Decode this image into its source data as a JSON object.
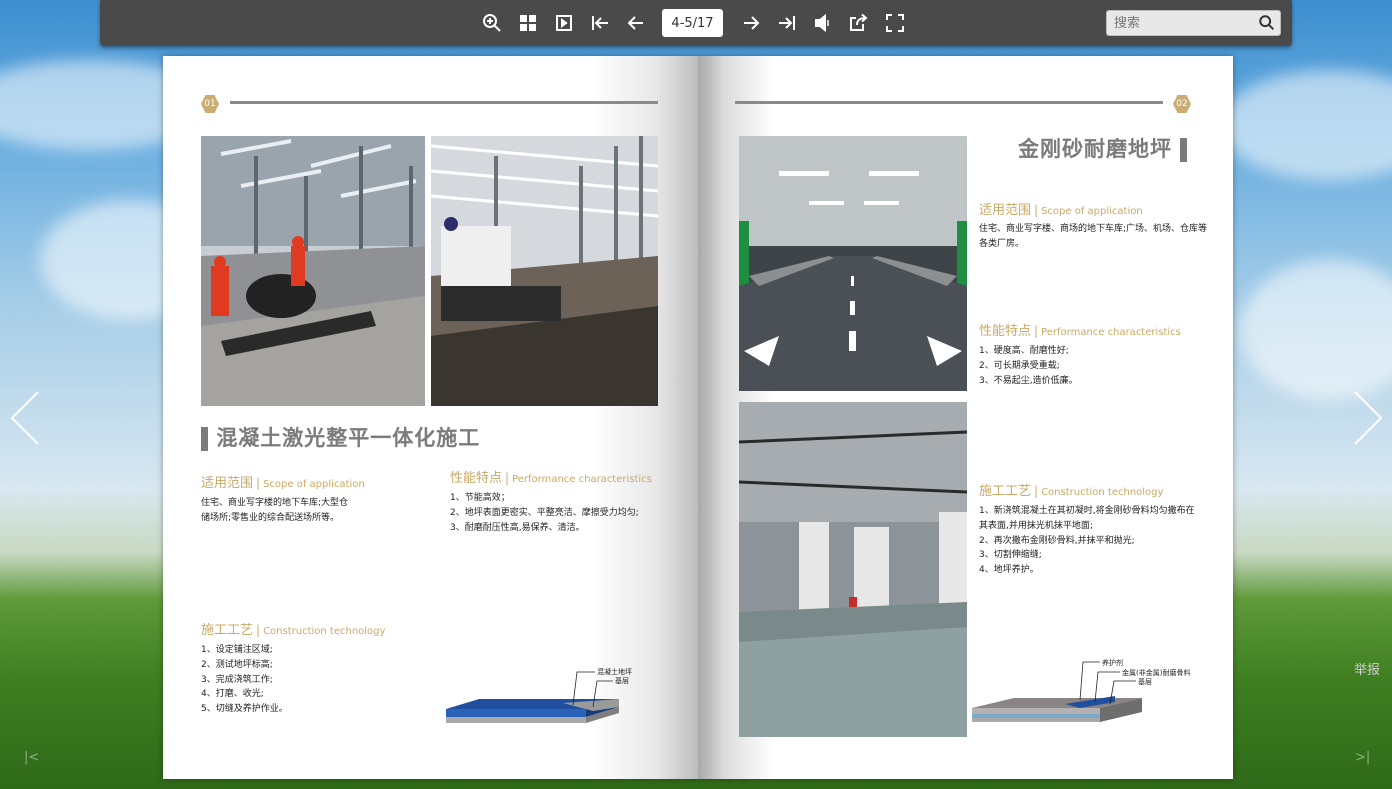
{
  "toolbar": {
    "page_indicator": "4-5/17",
    "search_placeholder": "搜索"
  },
  "left_page": {
    "number": "01",
    "title": "混凝土激光整平一体化施工",
    "scope": {
      "cn": "适用范围",
      "sep": "|",
      "en": "Scope of application",
      "lines": [
        "住宅、商业写字楼的地下车库;大型仓",
        "储场所;零售业的综合配送场所等。"
      ]
    },
    "performance": {
      "cn": "性能特点",
      "sep": "|",
      "en": "Performance characteristics",
      "lines": [
        "1、节能高效；",
        "2、地坪表面更密实、平整亮洁、摩擦受力均匀;",
        "3、耐磨耐压性高,易保养、清洁。"
      ]
    },
    "construction": {
      "cn": "施工工艺",
      "sep": "|",
      "en": "Construction technology",
      "lines": [
        "1、设定铺注区域;",
        "2、测试地坪标高;",
        "3、完成浇筑工作;",
        "4、打磨、收光;",
        "5、切缝及养护作业。"
      ]
    },
    "diagram_labels": [
      "混凝土地坪",
      "基层"
    ]
  },
  "right_page": {
    "number": "02",
    "title": "金刚砂耐磨地坪",
    "scope": {
      "cn": "适用范围",
      "sep": "|",
      "en": "Scope of application",
      "lines": [
        "住宅、商业写字楼、商场的地下车库;广场、机场、仓库等",
        "各类厂房。"
      ]
    },
    "performance": {
      "cn": "性能特点",
      "sep": "|",
      "en": "Performance characteristics",
      "lines": [
        "1、硬度高、耐磨性好;",
        "2、可长期承受重载;",
        "3、不易起尘,造价低廉。"
      ]
    },
    "construction": {
      "cn": "施工工艺",
      "sep": "|",
      "en": "Construction technology",
      "lines": [
        "1、新浇筑混凝土在其初凝时,将金刚砂骨料均匀撒布在",
        "其表面,并用抹光机抹平地面;",
        "2、再次撒布金刚砂骨料,并抹平和抛光;",
        "3、切割伸缩缝;",
        "4、地坪养护。"
      ]
    },
    "diagram_labels": [
      "养护剂",
      "金属(非金属)耐磨骨料",
      "基层"
    ]
  },
  "report_label": "举报",
  "first_label": "|<",
  "last_label": ">|",
  "colors": {
    "accent": "#c9a966",
    "toolbar": "#4a4a4a",
    "title_gray": "#7b7b7b"
  },
  "icons": [
    "zoom-in-icon",
    "thumbnails-icon",
    "single-page-icon",
    "first-page-icon",
    "prev-page-icon",
    "next-page-icon",
    "last-page-icon",
    "sound-icon",
    "share-icon",
    "fullscreen-icon",
    "search-icon",
    "prev-arrow-icon",
    "next-arrow-icon"
  ]
}
